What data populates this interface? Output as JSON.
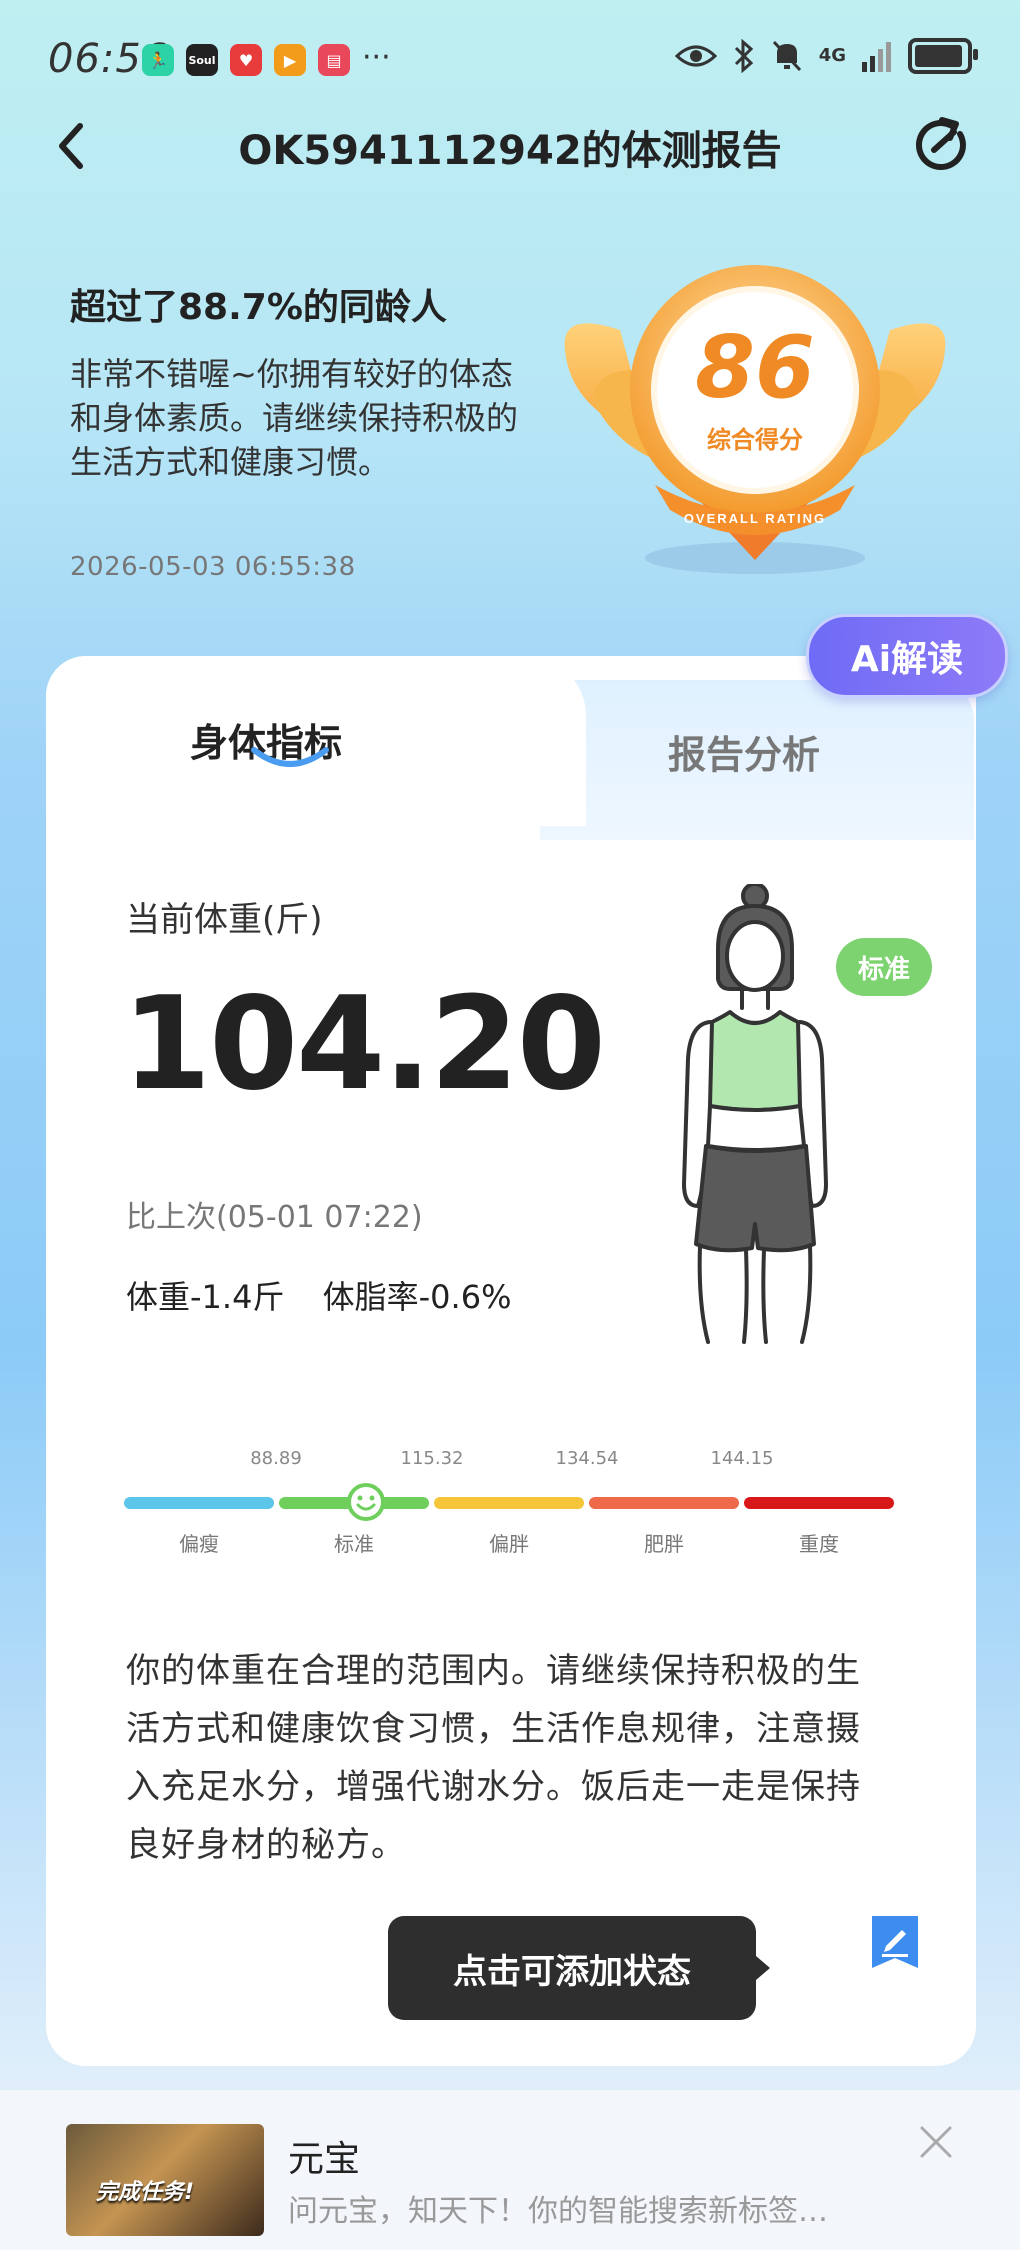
{
  "status_bar": {
    "time": "06:56",
    "icons": [
      "keep-app-icon",
      "soul-app-icon",
      "heart-app-icon",
      "video-app-icon",
      "book-app-icon"
    ],
    "more": "···",
    "network": "4G"
  },
  "header": {
    "title": "OK5941112942的体测报告"
  },
  "summary": {
    "title": "超过了88.7%的同龄人",
    "description": "非常不错喔~你拥有较好的体态和身体素质。请继续保持积极的生活方式和健康习惯。",
    "timestamp": "2026-05-03 06:55:38"
  },
  "score": {
    "value": "86",
    "label": "综合得分",
    "ribbon_text": "OVERALL RATING"
  },
  "ai_button": {
    "label": "Ai解读"
  },
  "tabs": [
    {
      "label": "身体指标",
      "active": true
    },
    {
      "label": "报告分析",
      "active": false
    }
  ],
  "weight": {
    "label": "当前体重(斤)",
    "value": "104.20",
    "compare_label": "比上次(05-01 07:22)",
    "weight_delta": "体重-1.4斤",
    "fat_delta": "体脂率-0.6%",
    "status_pill": "标准"
  },
  "scale": {
    "ticks": [
      "88.89",
      "115.32",
      "134.54",
      "144.15"
    ],
    "segments": [
      {
        "label": "偏瘦",
        "color": "#5bc5ea"
      },
      {
        "label": "标准",
        "color": "#6fcf5c"
      },
      {
        "label": "偏胖",
        "color": "#f5c53a"
      },
      {
        "label": "肥胖",
        "color": "#ef6a4a"
      },
      {
        "label": "重度",
        "color": "#d81818"
      }
    ],
    "current_position_fraction": 0.31
  },
  "advice": "你的体重在合理的范围内。请继续保持积极的生活方式和健康饮食习惯，生活作息规律，注意摄入充足水分，增强代谢水分。饭后走一走是保持良好身材的秘方。",
  "status_button": {
    "label": "点击可添加状态"
  },
  "ad": {
    "title": "元宝",
    "subtitle": "问元宝，知天下！你的智能搜索新标签…",
    "thumb_text": "完成任务!"
  },
  "colors": {
    "accent_orange": "#f08a24",
    "ai_purple": "#6f6bf5",
    "standard_green": "#7dd370"
  }
}
